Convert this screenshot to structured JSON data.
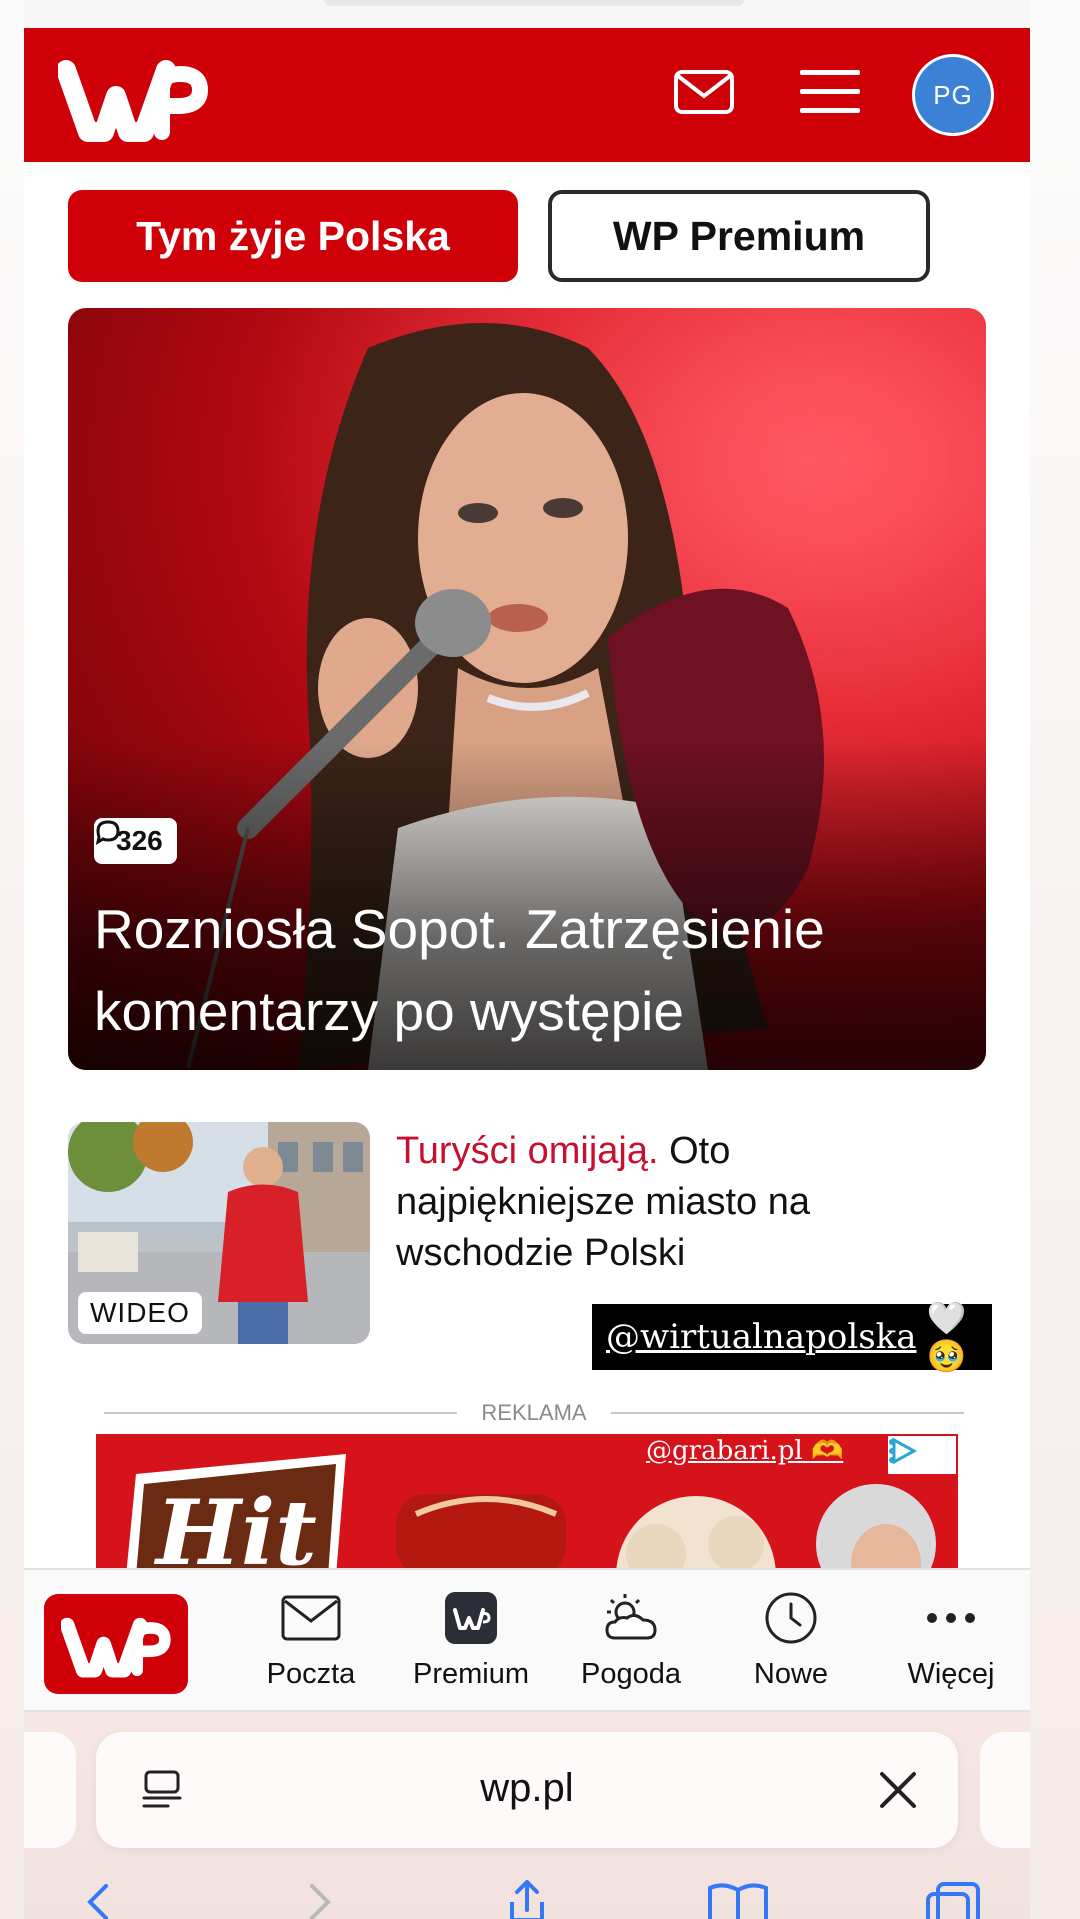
{
  "header": {
    "logo": "WP",
    "avatar_initials": "PG",
    "icons": [
      "mail-icon",
      "hamburger-menu-icon"
    ]
  },
  "chips": {
    "primary_label": "Tym żyje Polska",
    "secondary_label": "WP Premium"
  },
  "hero": {
    "comments_count": "326",
    "title": "Rozniosła Sopot. Zatrzęsienie komentarzy po występie"
  },
  "story": {
    "badge": "WIDEO",
    "highlight": "Turyści omijają.",
    "headline": " Oto najpiękniejsze miasto na wschodzie Polski"
  },
  "sticker": {
    "handle": "@wirtualnapolska",
    "emoji": "🤍🥹"
  },
  "ad": {
    "label": "REKLAMA",
    "handle": "@grabari.pl",
    "handle_emoji": "🫶"
  },
  "bottom_nav": {
    "items": [
      {
        "label": "Poczta",
        "icon": "envelope-icon"
      },
      {
        "label": "Premium",
        "icon": "wp-premium-icon"
      },
      {
        "label": "Pogoda",
        "icon": "weather-icon"
      },
      {
        "label": "Nowe",
        "icon": "clock-icon"
      },
      {
        "label": "Więcej",
        "icon": "more-dots-icon"
      }
    ]
  },
  "browser": {
    "url": "wp.pl"
  },
  "colors": {
    "brand_red": "#cf0008",
    "avatar_blue": "#3b82d6",
    "link_blue": "#3478f6"
  }
}
